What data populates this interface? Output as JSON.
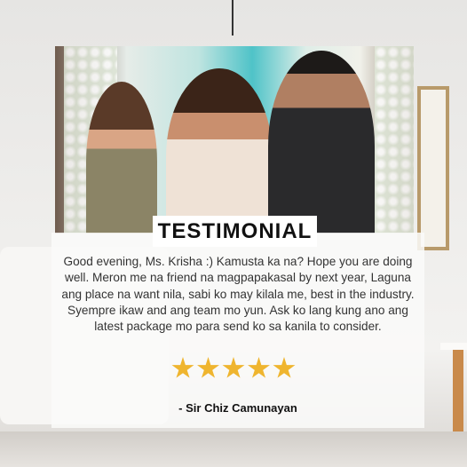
{
  "badge": {
    "title": "TESTIMONIAL"
  },
  "testimonial": {
    "text": "Good evening, Ms. Krisha :) Kamusta ka na? Hope you are doing well. Meron me na friend na magpapakasal by next year, Laguna ang place na want nila, sabi ko may kilala me, best in the industry. Syempre ikaw and ang team mo yun. Ask ko lang kung ano ang latest package mo para send ko sa kanila to consider.",
    "rating": 5,
    "rating_max": 5,
    "author": "- Sir Chiz Camunayan"
  },
  "colors": {
    "star": "#efb52f",
    "badge_bg": "#ffffff",
    "text": "#333333"
  }
}
